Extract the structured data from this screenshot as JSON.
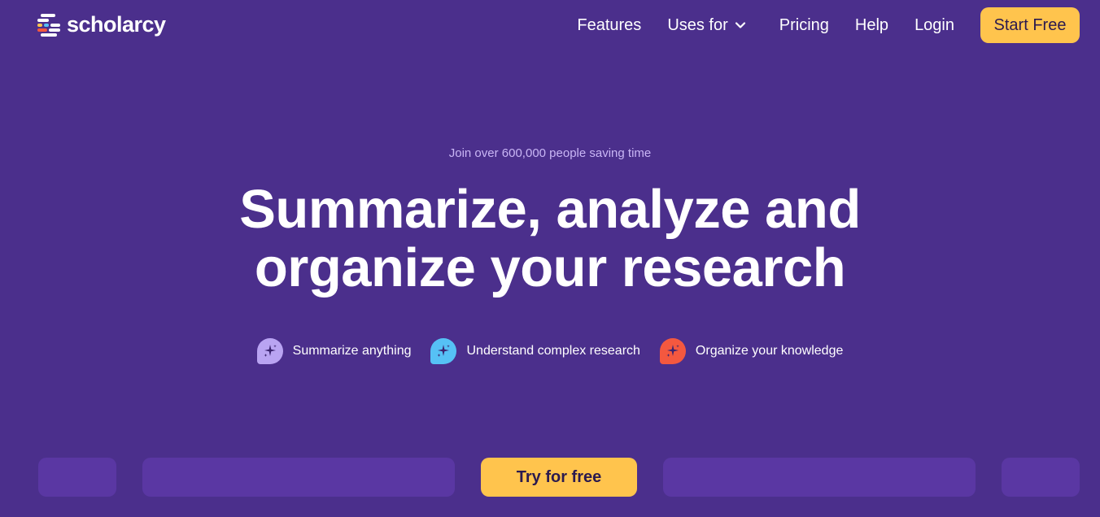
{
  "header": {
    "logo_text": "scholarcy",
    "nav": {
      "features": "Features",
      "uses_for": "Uses for",
      "pricing": "Pricing",
      "help": "Help",
      "login": "Login"
    },
    "start_free": "Start Free"
  },
  "hero": {
    "eyebrow": "Join over 600,000 people saving time",
    "headline_line1": "Summarize, analyze and",
    "headline_line2": "organize your research",
    "features": [
      {
        "label": "Summarize anything",
        "icon": "sparkle-chat-icon",
        "color": "#b9a4f2"
      },
      {
        "label": "Understand complex research",
        "icon": "sparkle-chat-icon",
        "color": "#56c1f5"
      },
      {
        "label": "Organize your knowledge",
        "icon": "sparkle-chat-icon",
        "color": "#f4583f"
      }
    ]
  },
  "cta": {
    "try_free": "Try for free"
  },
  "colors": {
    "background": "#4b2f8c",
    "accent": "#ffc44d",
    "eyebrow": "#c9b6f5",
    "placeholder": "#5a37a3"
  }
}
